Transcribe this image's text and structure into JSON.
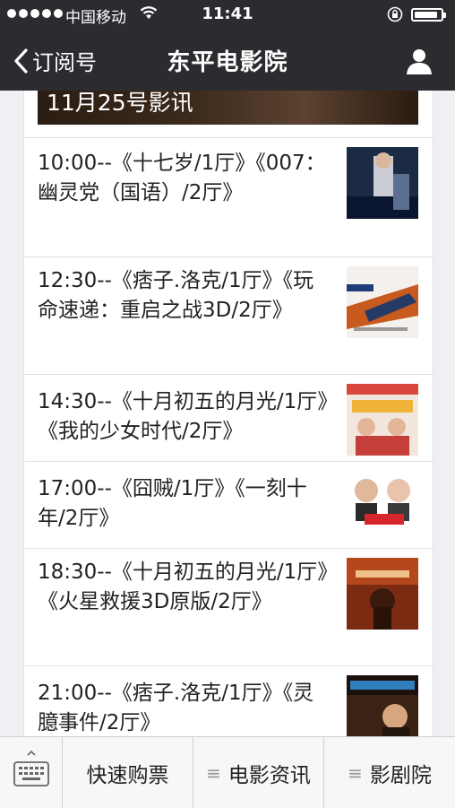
{
  "status_bar": {
    "carrier": "中国移动",
    "time": "11:41",
    "battery_level": 0.9
  },
  "nav": {
    "back_label": "订阅号",
    "title": "东平电影院"
  },
  "banner": {
    "text": "11月25号影讯"
  },
  "schedule": [
    {
      "text": "10:00--《十七岁/1厅》《007：幽灵党（国语）/2厅》"
    },
    {
      "text": "12:30--《痞子.洛克/1厅》《玩命速递：重启之战3D/2厅》"
    },
    {
      "text": "14:30--《十月初五的月光/1厅》《我的少女时代/2厅》"
    },
    {
      "text": "17:00--《囧贼/1厅》《一刻十年/2厅》"
    },
    {
      "text": "18:30--《十月初五的月光/1厅》《火星救援3D原版/2厅》"
    },
    {
      "text": "21:00--《痞子.洛克/1厅》《灵臆事件/2厅》"
    }
  ],
  "menu": {
    "item1": "快速购票",
    "item2": "电影资讯",
    "item3": "影剧院",
    "lines_icon": "≡"
  },
  "colors": {
    "nav_bg": "#2c2b30",
    "page_bg": "#efeff4"
  }
}
